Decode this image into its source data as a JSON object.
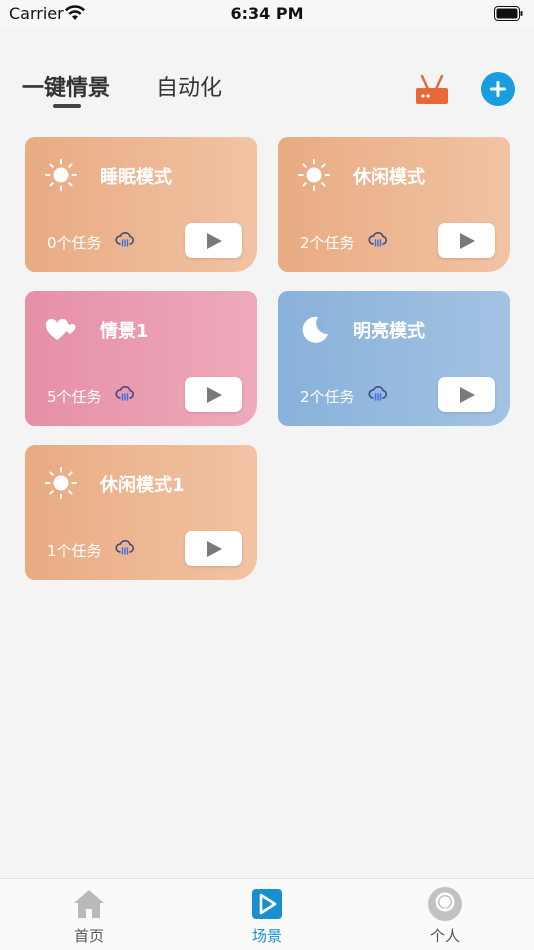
{
  "status_bar": {
    "carrier": "Carrier",
    "time": "6:34 PM"
  },
  "header": {
    "tabs": [
      {
        "label": "一键情景",
        "active": true
      },
      {
        "label": "自动化",
        "active": false
      }
    ],
    "router_icon": "router-icon",
    "add_icon": "plus-icon",
    "accent_color": "#1a9ce0"
  },
  "scenes": [
    {
      "title": "睡眠模式",
      "count_text": "0个任务",
      "icon": "sun-icon",
      "color": "orange"
    },
    {
      "title": "休闲模式",
      "count_text": "2个任务",
      "icon": "sun-icon",
      "color": "orange"
    },
    {
      "title": "情景1",
      "count_text": "5个任务",
      "icon": "heart-icon",
      "color": "pink"
    },
    {
      "title": "明亮模式",
      "count_text": "2个任务",
      "icon": "moon-icon",
      "color": "blue"
    },
    {
      "title": "休闲模式1",
      "count_text": "1个任务",
      "icon": "sun-icon",
      "color": "orange"
    }
  ],
  "bottom_nav": [
    {
      "label": "首页",
      "icon": "home-icon",
      "active": false
    },
    {
      "label": "场景",
      "icon": "scene-icon",
      "active": true
    },
    {
      "label": "个人",
      "icon": "person-icon",
      "active": false
    }
  ]
}
